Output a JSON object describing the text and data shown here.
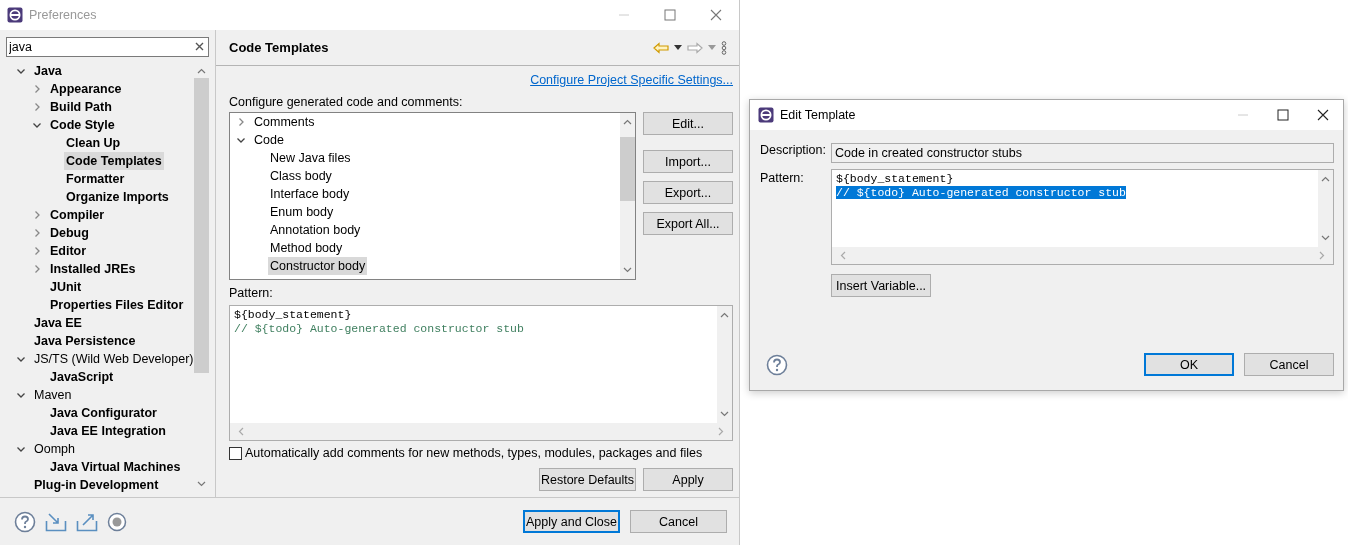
{
  "window": {
    "title": "Preferences"
  },
  "filter": {
    "value": "java"
  },
  "nav_tree": [
    {
      "label": "Java",
      "bold": true,
      "selected": false,
      "expanded": true,
      "children": [
        {
          "label": "Appearance",
          "bold": true,
          "selected": false,
          "expanded": false
        },
        {
          "label": "Build Path",
          "bold": true,
          "selected": false,
          "expanded": false
        },
        {
          "label": "Code Style",
          "bold": true,
          "selected": false,
          "expanded": true,
          "children": [
            {
              "label": "Clean Up",
              "bold": true,
              "selected": false
            },
            {
              "label": "Code Templates",
              "bold": true,
              "selected": true
            },
            {
              "label": "Formatter",
              "bold": true,
              "selected": false
            },
            {
              "label": "Organize Imports",
              "bold": true,
              "selected": false
            }
          ]
        },
        {
          "label": "Compiler",
          "bold": true,
          "selected": false,
          "expanded": false
        },
        {
          "label": "Debug",
          "bold": true,
          "selected": false,
          "expanded": false
        },
        {
          "label": "Editor",
          "bold": true,
          "selected": false,
          "expanded": false
        },
        {
          "label": "Installed JREs",
          "bold": true,
          "selected": false,
          "expanded": false
        },
        {
          "label": "JUnit",
          "bold": true,
          "selected": false
        },
        {
          "label": "Properties Files Editor",
          "bold": true,
          "selected": false
        }
      ]
    },
    {
      "label": "Java EE",
      "bold": true,
      "selected": false
    },
    {
      "label": "Java Persistence",
      "bold": true,
      "selected": false
    },
    {
      "label": "JS/TS (Wild Web Developer)",
      "bold": false,
      "selected": false,
      "expanded": true,
      "children": [
        {
          "label": "JavaScript",
          "bold": true,
          "selected": false
        }
      ]
    },
    {
      "label": "Maven",
      "bold": false,
      "selected": false,
      "expanded": true,
      "children": [
        {
          "label": "Java Configurator",
          "bold": true,
          "selected": false
        },
        {
          "label": "Java EE Integration",
          "bold": true,
          "selected": false
        }
      ]
    },
    {
      "label": "Oomph",
      "bold": false,
      "selected": false,
      "expanded": true,
      "children": [
        {
          "label": "Java Virtual Machines",
          "bold": true,
          "selected": false
        }
      ]
    },
    {
      "label": "Plug-in Development",
      "bold": true,
      "selected": false
    }
  ],
  "page": {
    "title": "Code Templates",
    "link": "Configure Project Specific Settings...",
    "tree_label": "Configure generated code and comments:",
    "templates": [
      {
        "label": "Comments",
        "selected": false,
        "expanded": false
      },
      {
        "label": "Code",
        "selected": false,
        "expanded": true,
        "children": [
          {
            "label": "New Java files",
            "selected": false
          },
          {
            "label": "Class body",
            "selected": false
          },
          {
            "label": "Interface body",
            "selected": false
          },
          {
            "label": "Enum body",
            "selected": false
          },
          {
            "label": "Annotation body",
            "selected": false
          },
          {
            "label": "Method body",
            "selected": false
          },
          {
            "label": "Constructor body",
            "selected": true
          }
        ]
      }
    ],
    "side_buttons": [
      "Edit...",
      "Import...",
      "Export...",
      "Export All..."
    ],
    "pattern_label": "Pattern:",
    "pattern_lines": [
      {
        "text": "${body_statement}",
        "kind": "code"
      },
      {
        "text": "// ${todo} Auto-generated constructor stub",
        "kind": "comment"
      }
    ],
    "auto_comments": {
      "label": "Automatically add comments for new methods, types, modules, packages and files",
      "checked": false
    },
    "buttons": [
      "Restore Defaults",
      "Apply"
    ]
  },
  "footer_buttons": [
    {
      "label": "Apply and Close",
      "default": true
    },
    {
      "label": "Cancel",
      "default": false
    }
  ],
  "dialog": {
    "title": "Edit Template",
    "description_label": "Description:",
    "description": "Code in created constructor stubs",
    "pattern_label": "Pattern:",
    "pattern_lines": [
      {
        "text": "${body_statement}",
        "selected": false
      },
      {
        "text": "// ${todo} Auto-generated constructor stub",
        "selected": true
      }
    ],
    "insert_button": "Insert Variable...",
    "buttons": [
      {
        "label": "OK",
        "default": true
      },
      {
        "label": "Cancel",
        "default": false
      }
    ]
  }
}
